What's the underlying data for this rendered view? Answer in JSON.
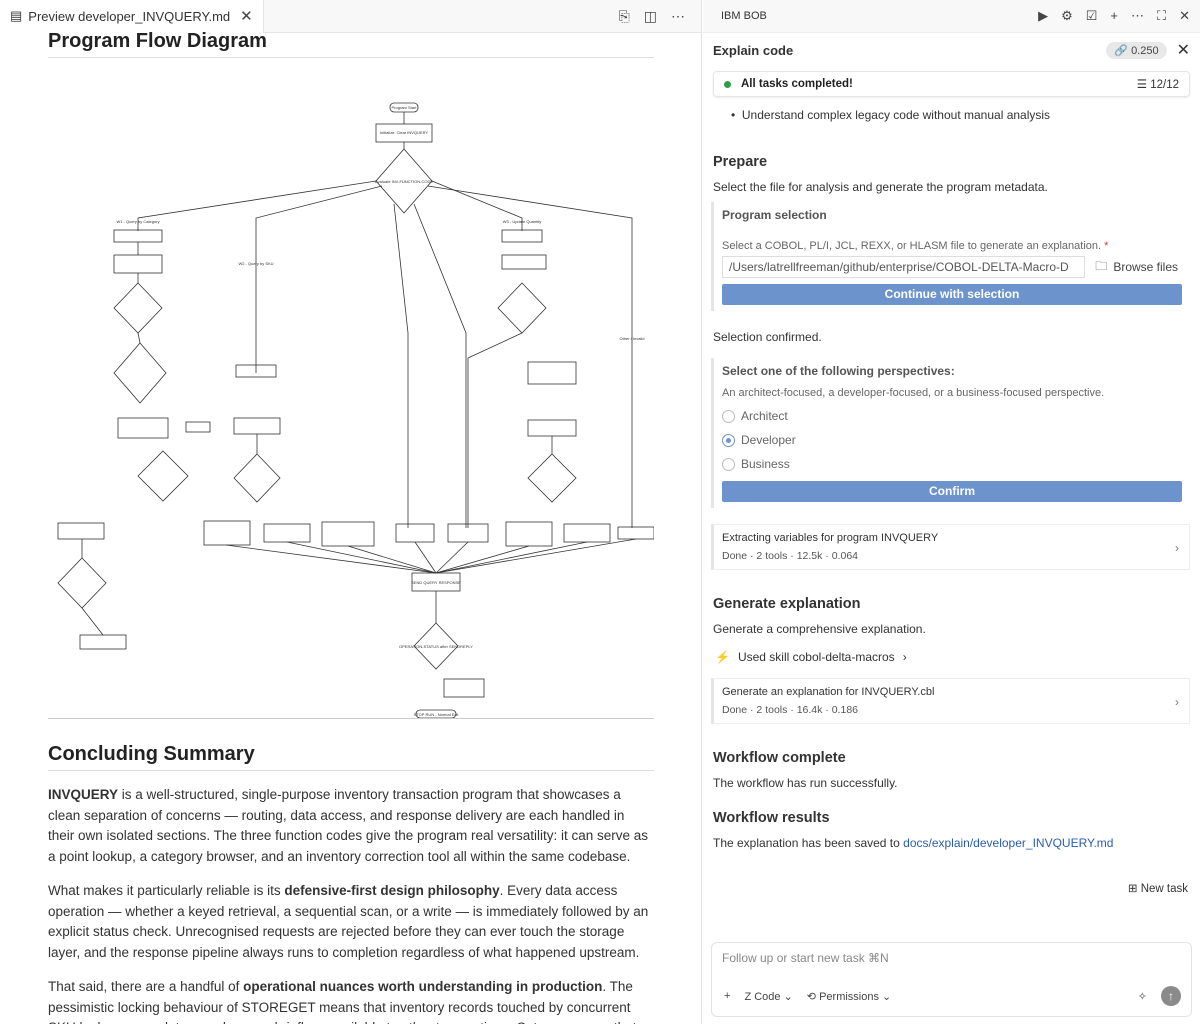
{
  "editor": {
    "tab_title": "Preview developer_INVQUERY.md",
    "heading_flow": "Program Flow Diagram",
    "heading_summary": "Concluding Summary",
    "p1_b": "INVQUERY",
    "p1_rest": " is a well-structured, single-purpose inventory transaction program that showcases a clean separation of concerns — routing, data access, and response delivery are each handled in their own isolated sections. The three function codes give the program real versatility: it can serve as a point lookup, a category browser, and an inventory correction tool all within the same codebase.",
    "p2_a": "What makes it particularly reliable is its ",
    "p2_b": "defensive-first design philosophy",
    "p2_c": ". Every data access operation — whether a keyed retrieval, a sequential scan, or a write — is immediately followed by an explicit status check. Unrecognised requests are rejected before they can ever touch the storage layer, and the response pipeline always runs to completion regardless of what happened upstream.",
    "p3_a": "That said, there are a handful of ",
    "p3_b": "operational nuances worth understanding in production",
    "p3_c": ". The pessimistic locking behaviour of STOREGET means that inventory records touched by concurrent SKU lookups or updates can become briefly unavailable to other transactions. Category scans that cross the"
  },
  "panel": {
    "title": "IBM BOB",
    "task_title": "Explain code",
    "cost": "0.250",
    "status": "All tasks completed!",
    "count": "12/12",
    "bullet": "Understand complex legacy code without manual analysis",
    "prepare_title": "Prepare",
    "prepare_desc": "Select the file for analysis and generate the program metadata.",
    "program_selection": "Program selection",
    "file_hint": "Select a COBOL, PL/I, JCL, REXX, or HLASM file to generate an explanation.",
    "path": "/Users/latrellfreeman/github/enterprise/COBOL-DELTA-Macro-D",
    "browse": "Browse files",
    "continue": "Continue with selection",
    "confirmed": "Selection confirmed.",
    "perspective_title": "Select one of the following perspectives:",
    "perspective_desc": "An architect-focused, a developer-focused, or a business-focused perspective.",
    "opt1": "Architect",
    "opt2": "Developer",
    "opt3": "Business",
    "selected_option": "Developer",
    "confirm": "Confirm",
    "step1_title": "Extracting variables for program INVQUERY",
    "step1_meta": "Done  · 2 tools  · 12.5k  · 0.064",
    "gen_title": "Generate explanation",
    "gen_desc": "Generate a comprehensive explanation.",
    "skill": "Used skill cobol-delta-macros",
    "step2_title": "Generate an explanation for INVQUERY.cbl",
    "step2_meta": "Done  · 2 tools  · 16.4k  · 0.186",
    "wf_title": "Workflow complete",
    "wf_desc": "The workflow has run successfully.",
    "res_title": "Workflow results",
    "res_desc": "The explanation has been saved to ",
    "res_link": "docs/explain/developer_INVQUERY.md",
    "new_task": "New task",
    "placeholder": "Follow up or start new task ⌘N",
    "mode": "Code",
    "permissions": "Permissions"
  },
  "diagram": {
    "start": "Program Start",
    "init": "Initialize: Clear INVQUERY",
    "decide": "Evaluate INV-FUNCTION-CODE",
    "b1": "W1 - Query by Category",
    "b2": "W2 - Query by SKU",
    "b3": "W3 - Update Quantity",
    "other": "Other / Invalid",
    "send": "SEND QUERY RESPONSE",
    "op": "OPERATION-STATUS after SENDREPLY",
    "stop": "STOP RUN - Normal Exit"
  }
}
